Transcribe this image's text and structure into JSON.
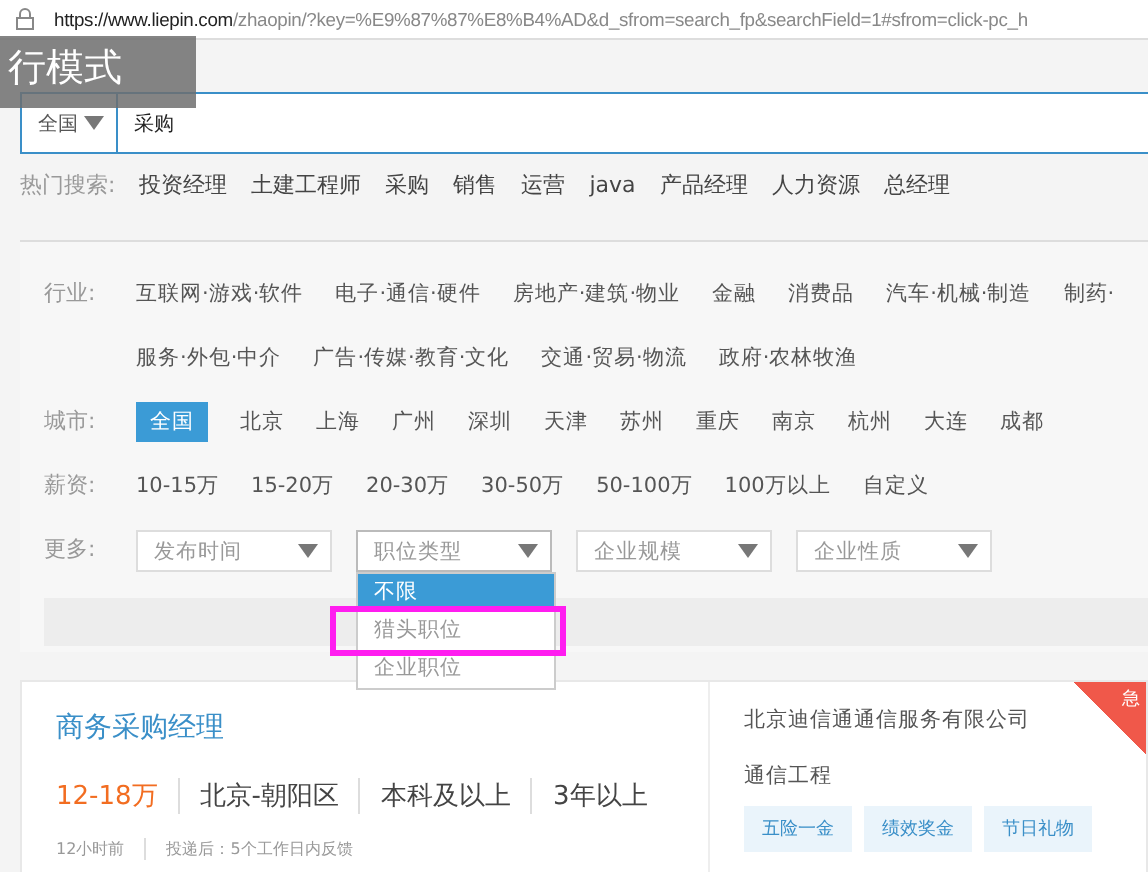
{
  "address_bar": {
    "url_host": "https://www.liepin.com",
    "url_path": "/zhaopin/?key=%E9%87%87%E8%B4%AD&d_sfrom=search_fp&searchField=1#sfrom=click-pc_h"
  },
  "toast": {
    "text": "行模式"
  },
  "search": {
    "region": "全国",
    "value": "采购"
  },
  "hot_search": {
    "label": "热门搜索:",
    "items": [
      "投资经理",
      "土建工程师",
      "采购",
      "销售",
      "运营",
      "java",
      "产品经理",
      "人力资源",
      "总经理"
    ]
  },
  "filters": [
    {
      "label": "行业:",
      "options": [
        {
          "text": "互联网·游戏·软件",
          "selected": false
        },
        {
          "text": "电子·通信·硬件",
          "selected": false
        },
        {
          "text": "房地产·建筑·物业",
          "selected": false
        },
        {
          "text": "金融",
          "selected": false
        },
        {
          "text": "消费品",
          "selected": false
        },
        {
          "text": "汽车·机械·制造",
          "selected": false
        },
        {
          "text": "制药·",
          "selected": false
        },
        {
          "text": "服务·外包·中介",
          "selected": false
        },
        {
          "text": "广告·传媒·教育·文化",
          "selected": false
        },
        {
          "text": "交通·贸易·物流",
          "selected": false
        },
        {
          "text": "政府·农林牧渔",
          "selected": false
        }
      ]
    },
    {
      "label": "城市:",
      "options": [
        {
          "text": "全国",
          "selected": true
        },
        {
          "text": "北京",
          "selected": false
        },
        {
          "text": "上海",
          "selected": false
        },
        {
          "text": "广州",
          "selected": false
        },
        {
          "text": "深圳",
          "selected": false
        },
        {
          "text": "天津",
          "selected": false
        },
        {
          "text": "苏州",
          "selected": false
        },
        {
          "text": "重庆",
          "selected": false
        },
        {
          "text": "南京",
          "selected": false
        },
        {
          "text": "杭州",
          "selected": false
        },
        {
          "text": "大连",
          "selected": false
        },
        {
          "text": "成都",
          "selected": false
        }
      ]
    },
    {
      "label": "薪资:",
      "options": [
        {
          "text": "10-15万",
          "selected": false
        },
        {
          "text": "15-20万",
          "selected": false
        },
        {
          "text": "20-30万",
          "selected": false
        },
        {
          "text": "30-50万",
          "selected": false
        },
        {
          "text": "50-100万",
          "selected": false
        },
        {
          "text": "100万以上",
          "selected": false
        },
        {
          "text": "自定义",
          "selected": false
        }
      ]
    }
  ],
  "more": {
    "label": "更多:",
    "selects": [
      {
        "placeholder": "发布时间",
        "expanded": false
      },
      {
        "placeholder": "职位类型",
        "expanded": true,
        "options": [
          {
            "text": "不限",
            "selected": true,
            "highlighted": false
          },
          {
            "text": "猎头职位",
            "selected": false,
            "highlighted": true
          },
          {
            "text": "企业职位",
            "selected": false,
            "highlighted": false
          }
        ]
      },
      {
        "placeholder": "企业规模",
        "expanded": false
      },
      {
        "placeholder": "企业性质",
        "expanded": false
      }
    ]
  },
  "job": {
    "title": "商务采购经理",
    "salary": "12-18万",
    "location": "北京-朝阳区",
    "education": "本科及以上",
    "experience": "3年以上",
    "posted": "12小时前",
    "feedback": "投递后：5个工作日内反馈",
    "company": "北京迪信通通信服务有限公司",
    "industry": "通信工程",
    "urgent_badge": "急",
    "benefits": [
      "五险一金",
      "绩效奖金",
      "节日礼物"
    ]
  }
}
